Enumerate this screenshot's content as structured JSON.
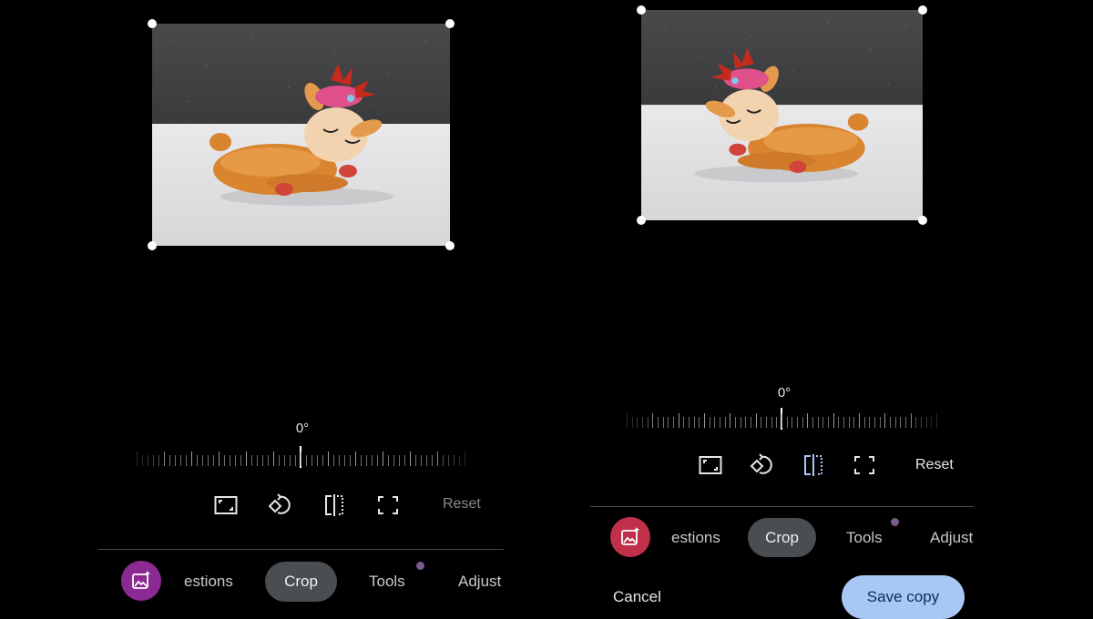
{
  "colors": {
    "accent_save": "#a9c7f5",
    "active_tab": "#4a4d52",
    "magic_left": "#8b2a92",
    "magic_right": "#c0304a",
    "notification_dot": "#7b5a8c"
  },
  "screens": [
    {
      "angle_label": "0°",
      "reset_label": "Reset",
      "tools": [
        "aspect-ratio-icon",
        "rotate-icon",
        "flip-icon",
        "free-crop-icon"
      ],
      "tabs": {
        "suggestions": "estions",
        "crop": "Crop",
        "tools": "Tools",
        "adjust": "Adjust"
      }
    },
    {
      "angle_label": "0°",
      "reset_label": "Reset",
      "tools": [
        "aspect-ratio-icon",
        "rotate-icon",
        "flip-icon",
        "free-crop-icon"
      ],
      "tabs": {
        "suggestions": "estions",
        "crop": "Crop",
        "tools": "Tools",
        "adjust": "Adjust"
      },
      "cancel_label": "Cancel",
      "save_label": "Save copy"
    }
  ]
}
